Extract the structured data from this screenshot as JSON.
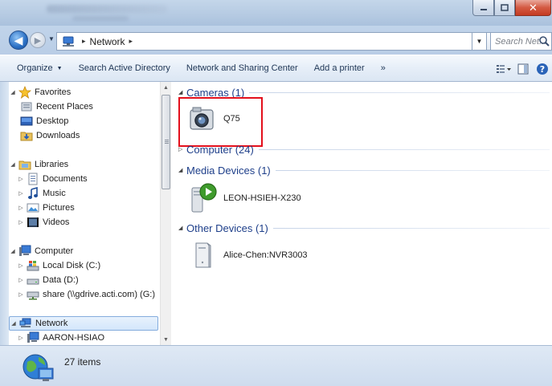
{
  "address": {
    "path": [
      "Network"
    ]
  },
  "search": {
    "placeholder": "Search Net..."
  },
  "toolbar": {
    "organize": "Organize",
    "search_ad": "Search Active Directory",
    "network_sharing": "Network and Sharing Center",
    "add_printer": "Add a printer",
    "more": "»"
  },
  "nav": {
    "favorites": "Favorites",
    "recent_places": "Recent Places",
    "desktop": "Desktop",
    "downloads": "Downloads",
    "libraries": "Libraries",
    "documents": "Documents",
    "music": "Music",
    "pictures": "Pictures",
    "videos": "Videos",
    "computer": "Computer",
    "local_disk": "Local Disk (C:)",
    "data": "Data (D:)",
    "share": "share (\\\\gdrive.acti.com) (G:)",
    "network": "Network",
    "aaron": "AARON-HSIAO"
  },
  "groups": {
    "cameras": {
      "title": "Cameras (1)",
      "items": [
        "Q75"
      ]
    },
    "computer": {
      "title": "Computer (24)"
    },
    "media": {
      "title": "Media Devices (1)",
      "items": [
        "LEON-HSIEH-X230"
      ]
    },
    "other": {
      "title": "Other Devices (1)",
      "items": [
        "Alice-Chen:NVR3003"
      ]
    }
  },
  "status": {
    "count": "27 items"
  },
  "colors": {
    "accent": "#1e3f8a",
    "highlight": "#e3101c"
  }
}
